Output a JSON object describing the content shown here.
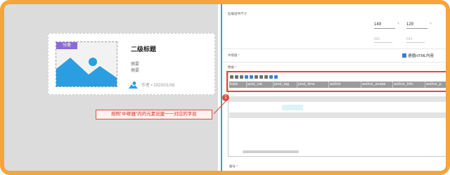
{
  "card": {
    "tag": "分类",
    "title": "二级标题",
    "summary_1": "摘要",
    "summary_2": "摘要",
    "author": "作者 • 2020/01/08"
  },
  "annotation": {
    "badge": "1",
    "text": "按照\"中继器\"内的元素创建一一对应的字段"
  },
  "panel": {
    "top_label": "挂载组件尺寸",
    "width_value": "149",
    "height_value": "129",
    "times": "×",
    "w2_value": "800",
    "h2_value": "543",
    "middle_label": "中继器 *",
    "html_checkbox_label": "遵循HTML内容",
    "data_label": "数据 *",
    "bottom_label": "编号 *"
  },
  "table": {
    "columns": [
      "topic",
      "post_cat",
      "post_tag",
      "post_time",
      "author",
      "author_avatar",
      "author_info",
      "author_p"
    ]
  },
  "colors": {
    "frame": "#f5a53a",
    "accent": "#e04b3b",
    "tag": "#8b6bd6",
    "image_blue": "#2a9ee0"
  }
}
